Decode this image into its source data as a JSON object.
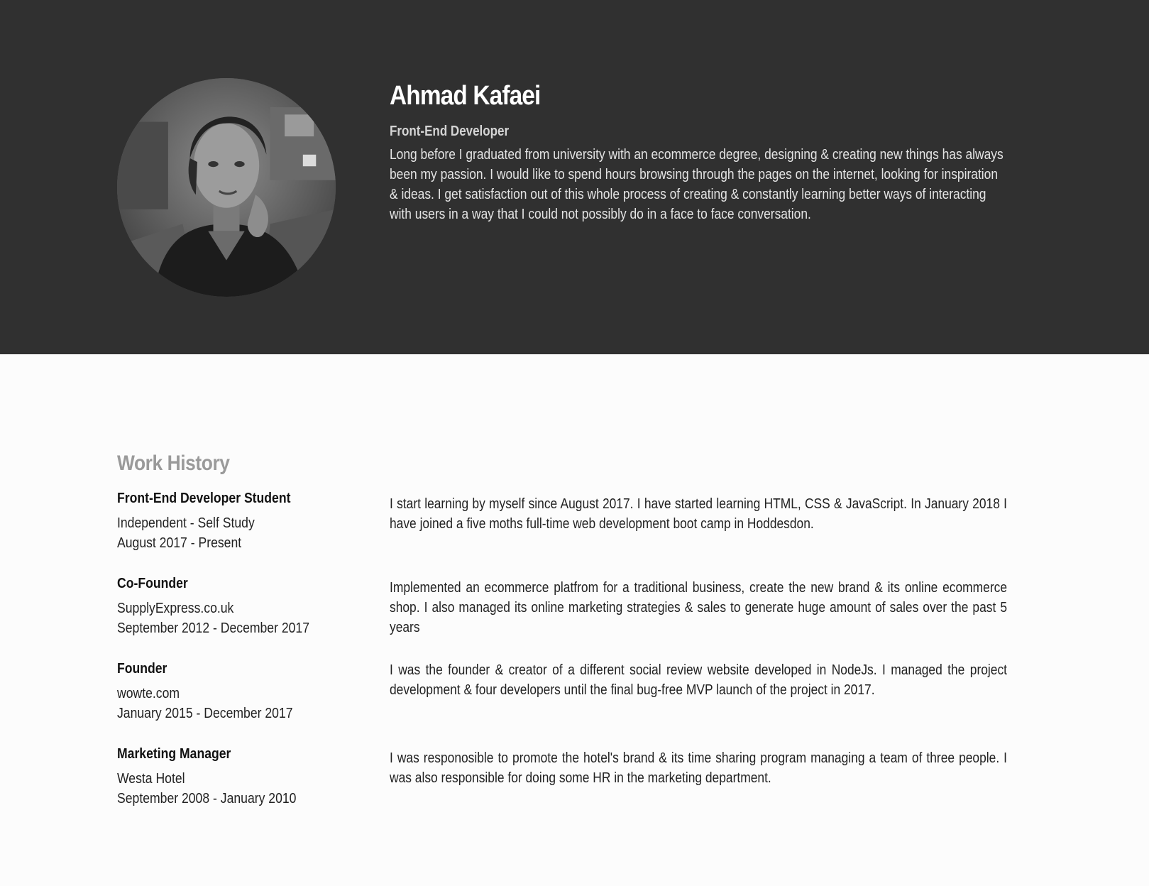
{
  "profile": {
    "name": "Ahmad Kafaei",
    "role": "Front-End Developer",
    "bio": "Long before I graduated from university with an ecommerce degree, designing & creating new things has always been my passion. I would like to spend hours browsing through the pages on the internet, looking for inspiration & ideas. I get satisfaction out of this whole process of creating & constantly learning better ways of interacting with users in a way that I could not possibly do in a face to face conversation."
  },
  "work": {
    "title": "Work History",
    "jobs": [
      {
        "title": "Front-End Developer Student",
        "company": "Independent - Self Study",
        "dates": "August 2017 - Present",
        "description": "I start learning by myself since August 2017. I have started learning HTML, CSS & JavaScript. In January 2018 I have joined a five moths full-time web development boot camp in Hoddesdon."
      },
      {
        "title": "Co-Founder",
        "company": "SupplyExpress.co.uk",
        "dates": "September 2012 - December 2017",
        "description": "Implemented an ecommerce platfrom for a traditional business, create the new brand & its online ecommerce shop. I also managed its online marketing strategies & sales to generate huge amount of sales over the past 5 years"
      },
      {
        "title": "Founder",
        "company": "wowte.com",
        "dates": "January 2015 - December 2017",
        "description": "I was the founder & creator of a different social review website developed in NodeJs. I managed the project development & four developers until the final bug-free MVP launch of the project in 2017."
      },
      {
        "title": "Marketing Manager",
        "company": "Westa Hotel",
        "dates": "September 2008 - January 2010",
        "description": "I was responosible to promote the hotel's brand & its time sharing program managing a team of three people. I was also responsible for doing some HR in the marketing department."
      }
    ]
  },
  "colors": {
    "hero_background": "#303030",
    "page_background": "#fcfcfc",
    "section_title": "#9a9a9a"
  }
}
